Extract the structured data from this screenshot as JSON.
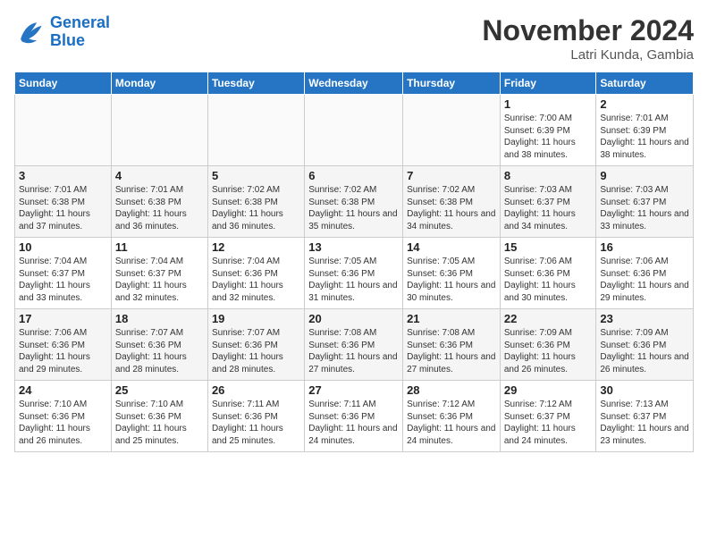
{
  "logo": {
    "line1": "General",
    "line2": "Blue"
  },
  "title": "November 2024",
  "location": "Latri Kunda, Gambia",
  "days_of_week": [
    "Sunday",
    "Monday",
    "Tuesday",
    "Wednesday",
    "Thursday",
    "Friday",
    "Saturday"
  ],
  "weeks": [
    [
      {
        "day": "",
        "info": ""
      },
      {
        "day": "",
        "info": ""
      },
      {
        "day": "",
        "info": ""
      },
      {
        "day": "",
        "info": ""
      },
      {
        "day": "",
        "info": ""
      },
      {
        "day": "1",
        "info": "Sunrise: 7:00 AM\nSunset: 6:39 PM\nDaylight: 11 hours and 38 minutes."
      },
      {
        "day": "2",
        "info": "Sunrise: 7:01 AM\nSunset: 6:39 PM\nDaylight: 11 hours and 38 minutes."
      }
    ],
    [
      {
        "day": "3",
        "info": "Sunrise: 7:01 AM\nSunset: 6:38 PM\nDaylight: 11 hours and 37 minutes."
      },
      {
        "day": "4",
        "info": "Sunrise: 7:01 AM\nSunset: 6:38 PM\nDaylight: 11 hours and 36 minutes."
      },
      {
        "day": "5",
        "info": "Sunrise: 7:02 AM\nSunset: 6:38 PM\nDaylight: 11 hours and 36 minutes."
      },
      {
        "day": "6",
        "info": "Sunrise: 7:02 AM\nSunset: 6:38 PM\nDaylight: 11 hours and 35 minutes."
      },
      {
        "day": "7",
        "info": "Sunrise: 7:02 AM\nSunset: 6:38 PM\nDaylight: 11 hours and 34 minutes."
      },
      {
        "day": "8",
        "info": "Sunrise: 7:03 AM\nSunset: 6:37 PM\nDaylight: 11 hours and 34 minutes."
      },
      {
        "day": "9",
        "info": "Sunrise: 7:03 AM\nSunset: 6:37 PM\nDaylight: 11 hours and 33 minutes."
      }
    ],
    [
      {
        "day": "10",
        "info": "Sunrise: 7:04 AM\nSunset: 6:37 PM\nDaylight: 11 hours and 33 minutes."
      },
      {
        "day": "11",
        "info": "Sunrise: 7:04 AM\nSunset: 6:37 PM\nDaylight: 11 hours and 32 minutes."
      },
      {
        "day": "12",
        "info": "Sunrise: 7:04 AM\nSunset: 6:36 PM\nDaylight: 11 hours and 32 minutes."
      },
      {
        "day": "13",
        "info": "Sunrise: 7:05 AM\nSunset: 6:36 PM\nDaylight: 11 hours and 31 minutes."
      },
      {
        "day": "14",
        "info": "Sunrise: 7:05 AM\nSunset: 6:36 PM\nDaylight: 11 hours and 30 minutes."
      },
      {
        "day": "15",
        "info": "Sunrise: 7:06 AM\nSunset: 6:36 PM\nDaylight: 11 hours and 30 minutes."
      },
      {
        "day": "16",
        "info": "Sunrise: 7:06 AM\nSunset: 6:36 PM\nDaylight: 11 hours and 29 minutes."
      }
    ],
    [
      {
        "day": "17",
        "info": "Sunrise: 7:06 AM\nSunset: 6:36 PM\nDaylight: 11 hours and 29 minutes."
      },
      {
        "day": "18",
        "info": "Sunrise: 7:07 AM\nSunset: 6:36 PM\nDaylight: 11 hours and 28 minutes."
      },
      {
        "day": "19",
        "info": "Sunrise: 7:07 AM\nSunset: 6:36 PM\nDaylight: 11 hours and 28 minutes."
      },
      {
        "day": "20",
        "info": "Sunrise: 7:08 AM\nSunset: 6:36 PM\nDaylight: 11 hours and 27 minutes."
      },
      {
        "day": "21",
        "info": "Sunrise: 7:08 AM\nSunset: 6:36 PM\nDaylight: 11 hours and 27 minutes."
      },
      {
        "day": "22",
        "info": "Sunrise: 7:09 AM\nSunset: 6:36 PM\nDaylight: 11 hours and 26 minutes."
      },
      {
        "day": "23",
        "info": "Sunrise: 7:09 AM\nSunset: 6:36 PM\nDaylight: 11 hours and 26 minutes."
      }
    ],
    [
      {
        "day": "24",
        "info": "Sunrise: 7:10 AM\nSunset: 6:36 PM\nDaylight: 11 hours and 26 minutes."
      },
      {
        "day": "25",
        "info": "Sunrise: 7:10 AM\nSunset: 6:36 PM\nDaylight: 11 hours and 25 minutes."
      },
      {
        "day": "26",
        "info": "Sunrise: 7:11 AM\nSunset: 6:36 PM\nDaylight: 11 hours and 25 minutes."
      },
      {
        "day": "27",
        "info": "Sunrise: 7:11 AM\nSunset: 6:36 PM\nDaylight: 11 hours and 24 minutes."
      },
      {
        "day": "28",
        "info": "Sunrise: 7:12 AM\nSunset: 6:36 PM\nDaylight: 11 hours and 24 minutes."
      },
      {
        "day": "29",
        "info": "Sunrise: 7:12 AM\nSunset: 6:37 PM\nDaylight: 11 hours and 24 minutes."
      },
      {
        "day": "30",
        "info": "Sunrise: 7:13 AM\nSunset: 6:37 PM\nDaylight: 11 hours and 23 minutes."
      }
    ]
  ]
}
